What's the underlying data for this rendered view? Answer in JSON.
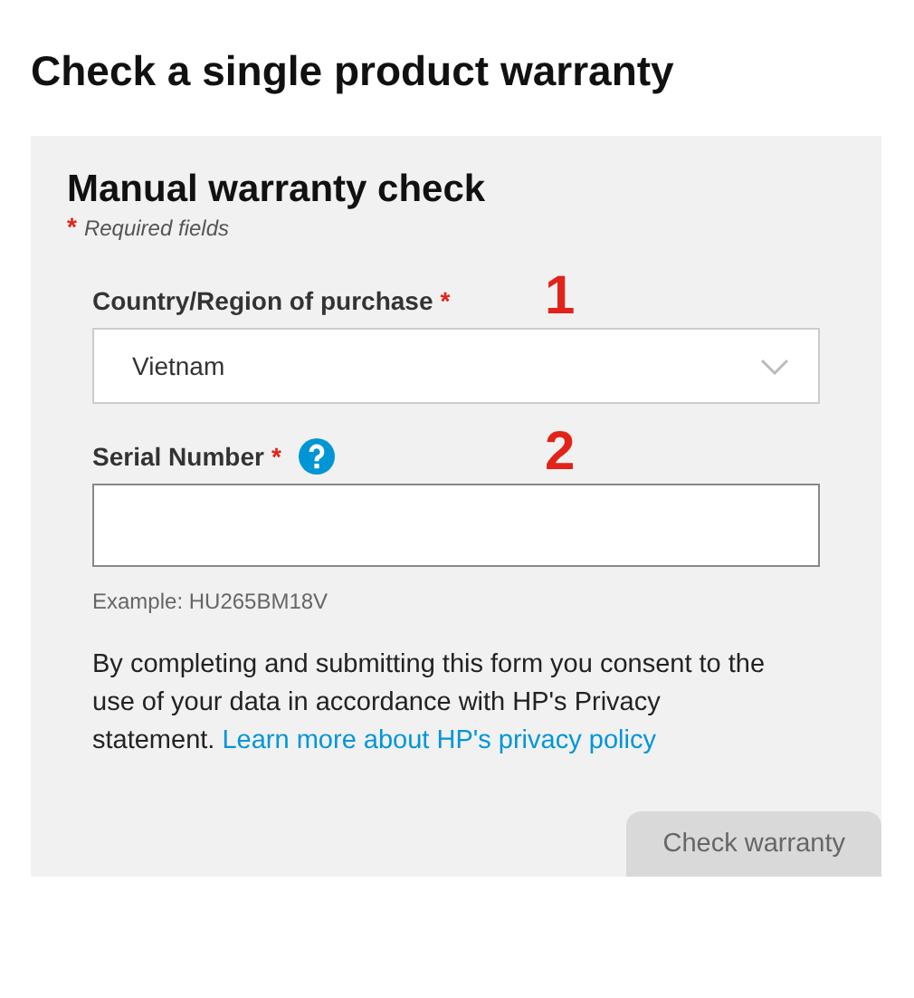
{
  "page_title": "Check a single product warranty",
  "form": {
    "heading": "Manual warranty check",
    "required_note": {
      "mark": "*",
      "text": "Required fields"
    },
    "fields": [
      {
        "kind": "select",
        "label": "Country/Region of purchase",
        "required_mark": "*",
        "help": false,
        "value": "Vietnam",
        "marker": "1"
      },
      {
        "kind": "text",
        "label": "Serial Number",
        "required_mark": "*",
        "help": true,
        "marker": "2",
        "hint": "Example: HU265BM18V"
      }
    ],
    "consent": {
      "text": "By completing and submitting this form you consent to the use of your data in accordance with HP's Privacy statement.",
      "link": "Learn more about HP's privacy policy"
    },
    "submit": {
      "label": "Check warranty",
      "disabled": true
    }
  }
}
